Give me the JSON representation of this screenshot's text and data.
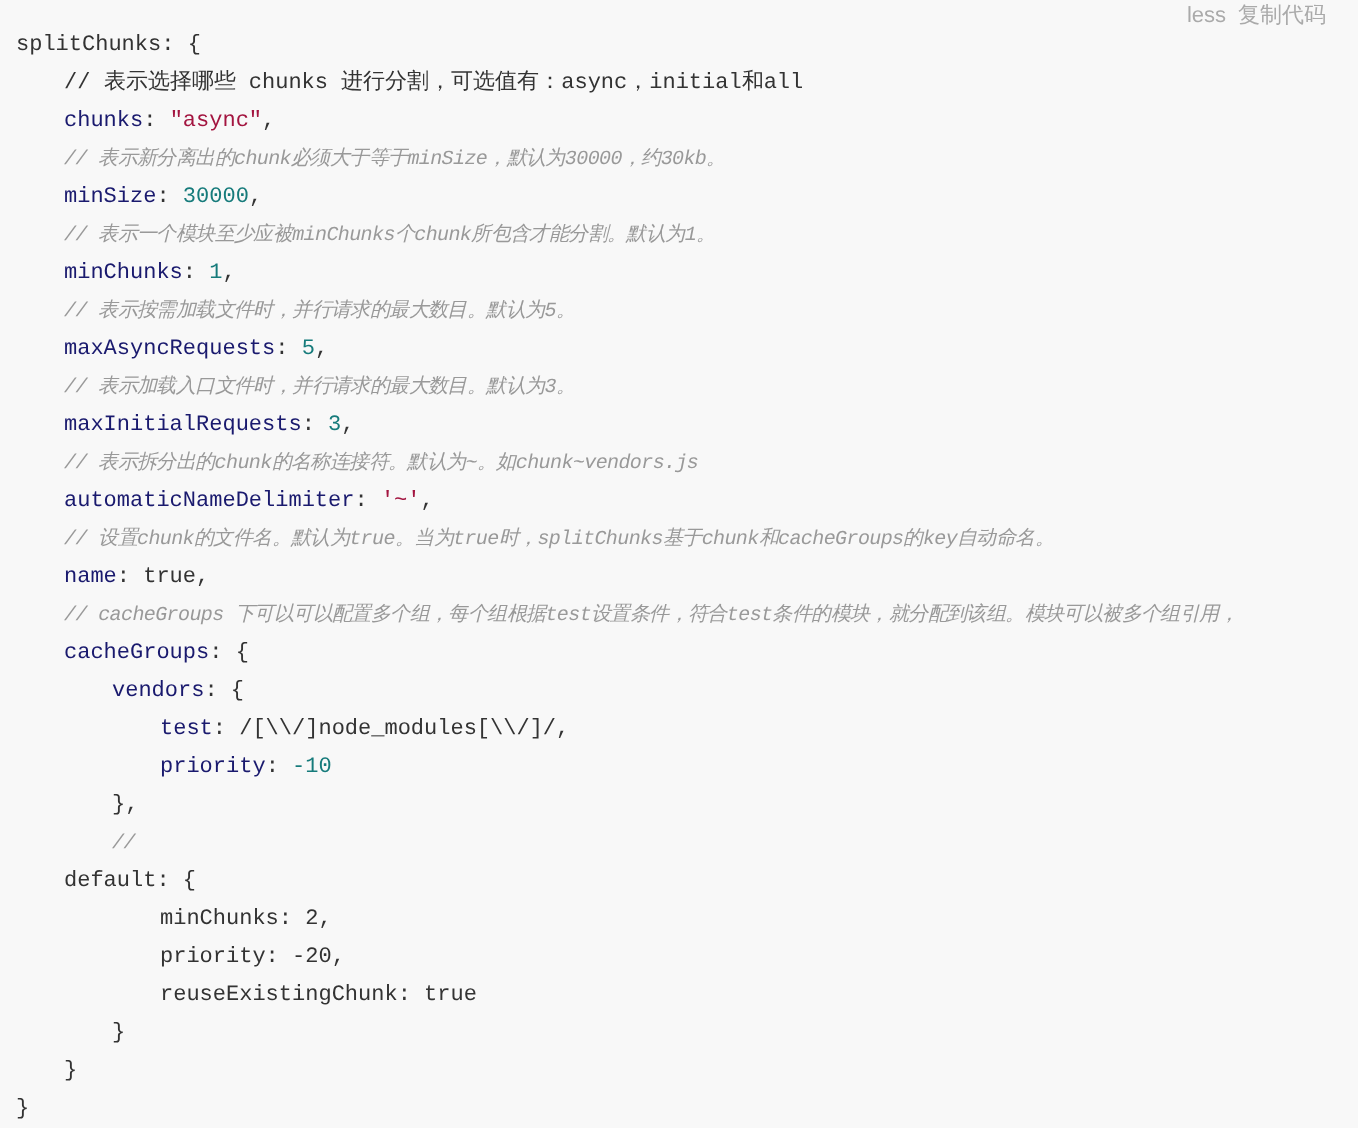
{
  "header": {
    "language": "less",
    "copy_button": "复制代码"
  },
  "lines": [
    {
      "tokens": [
        {
          "kind": "plain",
          "text": "splitChunks: {"
        }
      ],
      "children": [
        {
          "tokens": [
            {
              "kind": "plain",
              "text": "// 表示选择哪些 chunks 进行分割，可选值有：async，initial和all"
            }
          ]
        },
        {
          "tokens": [
            {
              "kind": "key",
              "text": "chunks"
            },
            {
              "kind": "plain",
              "text": ": "
            },
            {
              "kind": "string",
              "text": "\"async\""
            },
            {
              "kind": "plain",
              "text": ","
            }
          ]
        },
        {
          "tokens": [
            {
              "kind": "comment",
              "text": "// 表示新分离出的chunk必须大于等于minSize，默认为30000，约30kb。"
            }
          ]
        },
        {
          "tokens": [
            {
              "kind": "key",
              "text": "minSize"
            },
            {
              "kind": "plain",
              "text": ": "
            },
            {
              "kind": "number",
              "text": "30000"
            },
            {
              "kind": "plain",
              "text": ","
            }
          ]
        },
        {
          "tokens": [
            {
              "kind": "comment",
              "text": "// 表示一个模块至少应被minChunks个chunk所包含才能分割。默认为1。"
            }
          ]
        },
        {
          "tokens": [
            {
              "kind": "key",
              "text": "minChunks"
            },
            {
              "kind": "plain",
              "text": ": "
            },
            {
              "kind": "number",
              "text": "1"
            },
            {
              "kind": "plain",
              "text": ","
            }
          ]
        },
        {
          "tokens": [
            {
              "kind": "comment",
              "text": "// 表示按需加载文件时，并行请求的最大数目。默认为5。"
            }
          ]
        },
        {
          "tokens": [
            {
              "kind": "key",
              "text": "maxAsyncRequests"
            },
            {
              "kind": "plain",
              "text": ": "
            },
            {
              "kind": "number",
              "text": "5"
            },
            {
              "kind": "plain",
              "text": ","
            }
          ]
        },
        {
          "tokens": [
            {
              "kind": "comment",
              "text": "// 表示加载入口文件时，并行请求的最大数目。默认为3。"
            }
          ]
        },
        {
          "tokens": [
            {
              "kind": "key",
              "text": "maxInitialRequests"
            },
            {
              "kind": "plain",
              "text": ": "
            },
            {
              "kind": "number",
              "text": "3"
            },
            {
              "kind": "plain",
              "text": ","
            }
          ]
        },
        {
          "tokens": [
            {
              "kind": "comment",
              "text": "// 表示拆分出的chunk的名称连接符。默认为~。如chunk~vendors.js"
            }
          ]
        },
        {
          "tokens": [
            {
              "kind": "key",
              "text": "automaticNameDelimiter"
            },
            {
              "kind": "plain",
              "text": ": "
            },
            {
              "kind": "string",
              "text": "'~'"
            },
            {
              "kind": "plain",
              "text": ","
            }
          ]
        },
        {
          "tokens": [
            {
              "kind": "comment",
              "text": "// 设置chunk的文件名。默认为true。当为true时，splitChunks基于chunk和cacheGroups的key自动命名。"
            }
          ]
        },
        {
          "tokens": [
            {
              "kind": "key",
              "text": "name"
            },
            {
              "kind": "plain",
              "text": ": true,"
            }
          ]
        },
        {
          "tokens": [
            {
              "kind": "comment",
              "text": "// cacheGroups 下可以可以配置多个组，每个组根据test设置条件，符合test条件的模块，就分配到该组。模块可以被多个组引用，"
            }
          ]
        },
        {
          "tokens": [
            {
              "kind": "key",
              "text": "cacheGroups"
            },
            {
              "kind": "plain",
              "text": ": {"
            }
          ],
          "children": [
            {
              "tokens": [
                {
                  "kind": "key",
                  "text": "vendors"
                },
                {
                  "kind": "plain",
                  "text": ": {"
                }
              ],
              "children": [
                {
                  "tokens": [
                    {
                      "kind": "key",
                      "text": "test"
                    },
                    {
                      "kind": "plain",
                      "text": ": /[\\\\/]node_modules[\\\\/]/,"
                    }
                  ]
                },
                {
                  "tokens": [
                    {
                      "kind": "key",
                      "text": "priority"
                    },
                    {
                      "kind": "plain",
                      "text": ": "
                    },
                    {
                      "kind": "number",
                      "text": "-10"
                    }
                  ]
                }
              ]
            },
            {
              "tokens": [
                {
                  "kind": "plain",
                  "text": "},"
                }
              ]
            },
            {
              "tokens": [
                {
                  "kind": "comment",
                  "text": "//"
                }
              ]
            }
          ]
        },
        {
          "tokens": [
            {
              "kind": "plain",
              "text": "default: {"
            }
          ],
          "children": [
            {
              "children": [
                {
                  "tokens": [
                    {
                      "kind": "plain",
                      "text": "minChunks: 2,"
                    }
                  ]
                },
                {
                  "tokens": [
                    {
                      "kind": "plain",
                      "text": "priority: -20,"
                    }
                  ]
                },
                {
                  "tokens": [
                    {
                      "kind": "plain",
                      "text": "reuseExistingChunk: true"
                    }
                  ]
                }
              ]
            },
            {
              "tokens": [
                {
                  "kind": "plain",
                  "text": "}"
                }
              ]
            }
          ]
        },
        {
          "tokens": [
            {
              "kind": "plain",
              "text": "}"
            }
          ]
        }
      ]
    },
    {
      "tokens": [
        {
          "kind": "plain",
          "text": "}"
        }
      ]
    }
  ]
}
